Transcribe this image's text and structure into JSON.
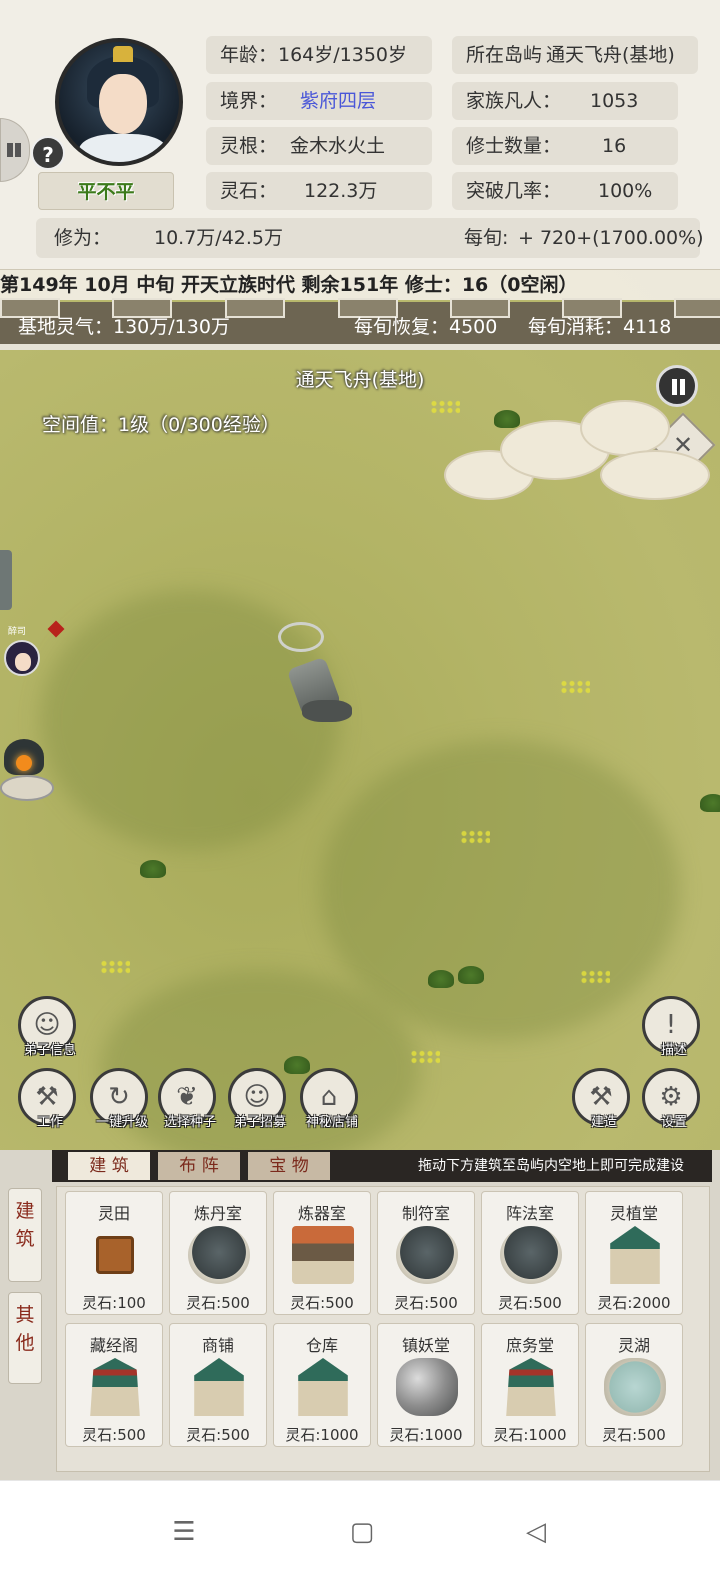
{
  "profile": {
    "name": "平不平",
    "help_symbol": "?",
    "age_label": "年龄：",
    "age_value": "164岁/1350岁",
    "realm_label": "境界：",
    "realm_value": "紫府四层",
    "root_label": "灵根：",
    "root_value": "金木水火土",
    "stones_label": "灵石：",
    "stones_value": "122.3万",
    "island_label": "所在岛屿",
    "island_value": "通天飞舟(基地)",
    "family_label": "家族凡人：",
    "family_value": "1053",
    "cultivators_label": "修士数量：",
    "cultivators_value": "16",
    "breakthrough_label": "突破几率：",
    "breakthrough_value": "100%",
    "cultivation_label": "修为：",
    "cultivation_value": "10.7万/42.5万",
    "per_tick_label": "每旬:",
    "per_tick_value": "+ 720+(1700.00%)"
  },
  "date_bar": "第149年 10月 中旬  开天立族时代 剩余151年  修士：16（0空闲）",
  "base": {
    "qi_label": "基地灵气：130万/130万",
    "recover_label": "每旬恢复：4500",
    "consume_label": "每旬消耗：4118",
    "map_title": "通天飞舟(基地)",
    "space_value": "空间值：1级（0/300经验）",
    "npc_name": "醉司"
  },
  "actions": {
    "disciple_info": "弟子信息",
    "work": "工作",
    "upgrade_all": "一键升级",
    "choose_seed": "选择种子",
    "recruit": "弟子招募",
    "shop": "神秘店铺",
    "describe": "描述",
    "build": "建造",
    "settings": "设置"
  },
  "build_panel": {
    "side_tabs": [
      "建筑",
      "其他"
    ],
    "tabs": [
      "建 筑",
      "布 阵",
      "宝 物"
    ],
    "hint": "拖动下方建筑至岛屿内空地上即可完成建设",
    "buildings": [
      {
        "name": "灵田",
        "cost": "灵石:100",
        "icon": "field-icon"
      },
      {
        "name": "炼丹室",
        "cost": "灵石:500",
        "icon": "alchemy-icon"
      },
      {
        "name": "炼器室",
        "cost": "灵石:500",
        "icon": "forge-icon"
      },
      {
        "name": "制符室",
        "cost": "灵石:500",
        "icon": "talisman-icon"
      },
      {
        "name": "阵法室",
        "cost": "灵石:500",
        "icon": "formation-icon"
      },
      {
        "name": "灵植堂",
        "cost": "灵石:2000",
        "icon": "herb-hall-icon"
      },
      {
        "name": "藏经阁",
        "cost": "灵石:500",
        "icon": "library-icon"
      },
      {
        "name": "商铺",
        "cost": "灵石:500",
        "icon": "shop-icon"
      },
      {
        "name": "仓库",
        "cost": "灵石:1000",
        "icon": "warehouse-icon"
      },
      {
        "name": "镇妖堂",
        "cost": "灵石:1000",
        "icon": "demon-hall-icon"
      },
      {
        "name": "庶务堂",
        "cost": "灵石:1000",
        "icon": "affairs-hall-icon"
      },
      {
        "name": "灵湖",
        "cost": "灵石:500",
        "icon": "lake-icon"
      }
    ]
  },
  "colors": {
    "realm": "#4a57d8",
    "name": "#3c7a1a",
    "tab_text": "#7b2a1c"
  }
}
